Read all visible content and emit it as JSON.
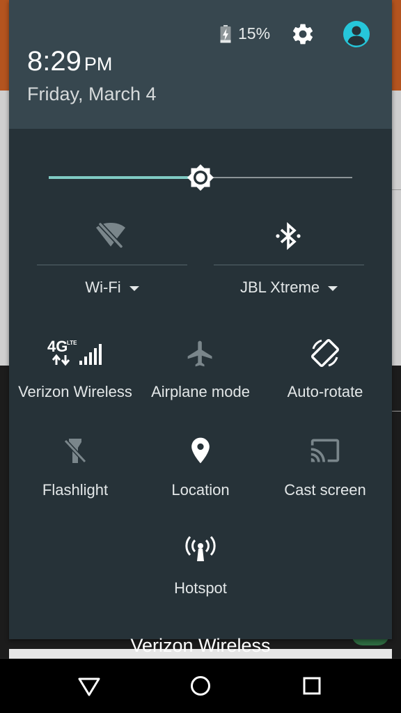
{
  "status": {
    "battery_percent": "15%",
    "battery_level": 0.15,
    "battery_charging": true
  },
  "header": {
    "time": "8:29",
    "ampm": "PM",
    "date": "Friday, March 4"
  },
  "brightness": {
    "level": 0.5
  },
  "dual_tiles": [
    {
      "label": "Wi-Fi",
      "icon": "wifi-off-icon",
      "enabled": false
    },
    {
      "label": "JBL Xtreme",
      "icon": "bluetooth-connected-icon",
      "enabled": true
    }
  ],
  "tiles": [
    {
      "label": "Verizon Wireless",
      "icon": "cellular-4g-lte-icon",
      "network": "4G",
      "network_sub": "LTE",
      "enabled": true
    },
    {
      "label": "Airplane mode",
      "icon": "airplane-icon",
      "enabled": false
    },
    {
      "label": "Auto-rotate",
      "icon": "auto-rotate-icon",
      "enabled": true
    },
    {
      "label": "Flashlight",
      "icon": "flashlight-off-icon",
      "enabled": false
    },
    {
      "label": "Location",
      "icon": "location-pin-icon",
      "enabled": true
    },
    {
      "label": "Cast screen",
      "icon": "cast-icon",
      "enabled": false
    },
    {
      "label": "Hotspot",
      "icon": "hotspot-icon",
      "enabled": true
    }
  ],
  "lockscreen_carrier": "Verizon Wireless",
  "navbar": {
    "buttons": [
      "back-icon",
      "home-icon",
      "recents-icon"
    ]
  },
  "colors": {
    "shade_bg": "#263238",
    "header_bg": "#37474f",
    "accent": "#80cbc4",
    "avatar": "#26c6da",
    "inactive_icon": "#7a868b"
  }
}
